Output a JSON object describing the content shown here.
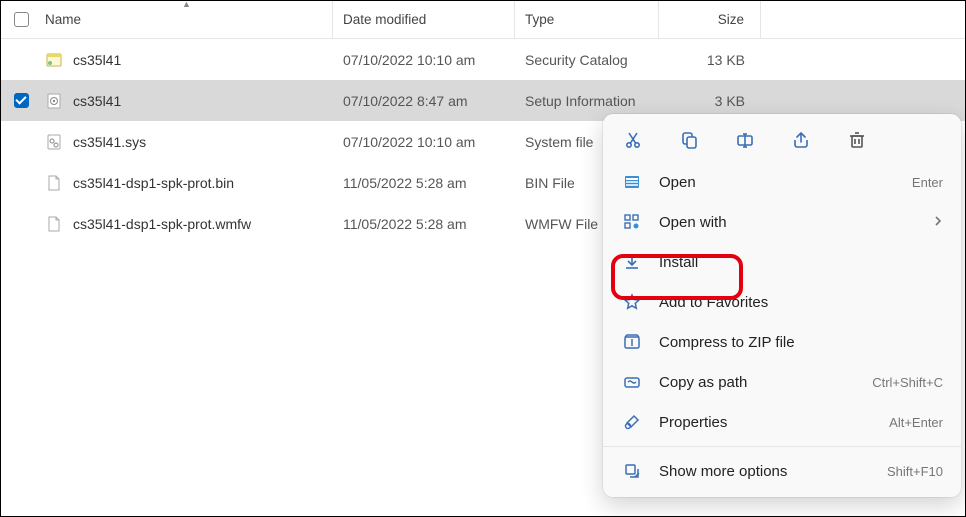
{
  "columns": {
    "name": "Name",
    "date": "Date modified",
    "type": "Type",
    "size": "Size"
  },
  "files": [
    {
      "name": "cs35l41",
      "date": "07/10/2022 10:10 am",
      "type": "Security Catalog",
      "size": "13 KB",
      "selected": false
    },
    {
      "name": "cs35l41",
      "date": "07/10/2022 8:47 am",
      "type": "Setup Information",
      "size": "3 KB",
      "selected": true
    },
    {
      "name": "cs35l41.sys",
      "date": "07/10/2022 10:10 am",
      "type": "System file",
      "size": "",
      "selected": false
    },
    {
      "name": "cs35l41-dsp1-spk-prot.bin",
      "date": "11/05/2022 5:28 am",
      "type": "BIN File",
      "size": "",
      "selected": false
    },
    {
      "name": "cs35l41-dsp1-spk-prot.wmfw",
      "date": "11/05/2022 5:28 am",
      "type": "WMFW File",
      "size": "",
      "selected": false
    }
  ],
  "ctx": {
    "open": {
      "label": "Open",
      "shortcut": "Enter"
    },
    "openwith": {
      "label": "Open with"
    },
    "install": {
      "label": "Install"
    },
    "fav": {
      "label": "Add to Favorites"
    },
    "zip": {
      "label": "Compress to ZIP file"
    },
    "copypath": {
      "label": "Copy as path",
      "shortcut": "Ctrl+Shift+C"
    },
    "props": {
      "label": "Properties",
      "shortcut": "Alt+Enter"
    },
    "more": {
      "label": "Show more options",
      "shortcut": "Shift+F10"
    }
  }
}
